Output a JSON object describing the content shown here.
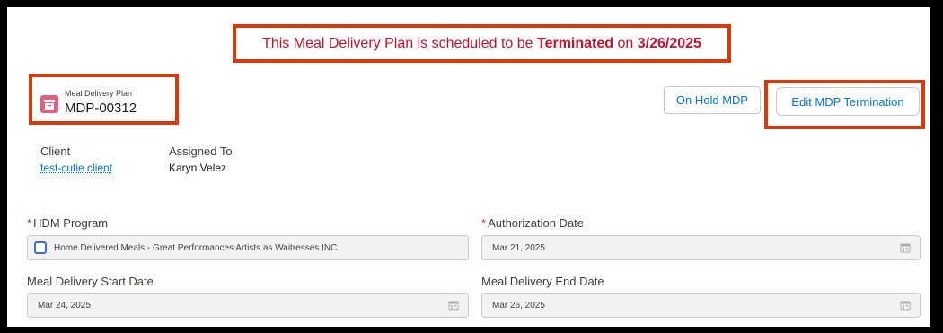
{
  "banner": {
    "prefix": "This Meal Delivery Plan is scheduled to be ",
    "status": "Terminated",
    "middle": " on ",
    "date": "3/26/2025"
  },
  "record": {
    "type_label": "Meal Delivery Plan",
    "name": "MDP-00312",
    "icon": "archive-box-icon"
  },
  "actions": {
    "on_hold_label": "On Hold MDP",
    "edit_termination_label": "Edit MDP Termination"
  },
  "summary": {
    "client_label": "Client",
    "client_value": "test-cutie client",
    "assigned_label": "Assigned To",
    "assigned_value": "Karyn Velez"
  },
  "form": {
    "hdm_program": {
      "label": "HDM Program",
      "required": true,
      "value": "Home Delivered Meals - Great Performances Artists as Waitresses INC."
    },
    "authorization_date": {
      "label": "Authorization Date",
      "required": true,
      "value": "Mar 21, 2025"
    },
    "start_date": {
      "label": "Meal Delivery Start Date",
      "required": false,
      "value": "Mar 24, 2025"
    },
    "end_date": {
      "label": "Meal Delivery End Date",
      "required": false,
      "value": "Mar 26, 2025"
    }
  },
  "colors": {
    "highlight": "#d83a0e",
    "banner_text": "#c8102e",
    "brand_blue": "#0176d3",
    "record_icon": "#e0607e",
    "required_asterisk": "#c23934"
  }
}
